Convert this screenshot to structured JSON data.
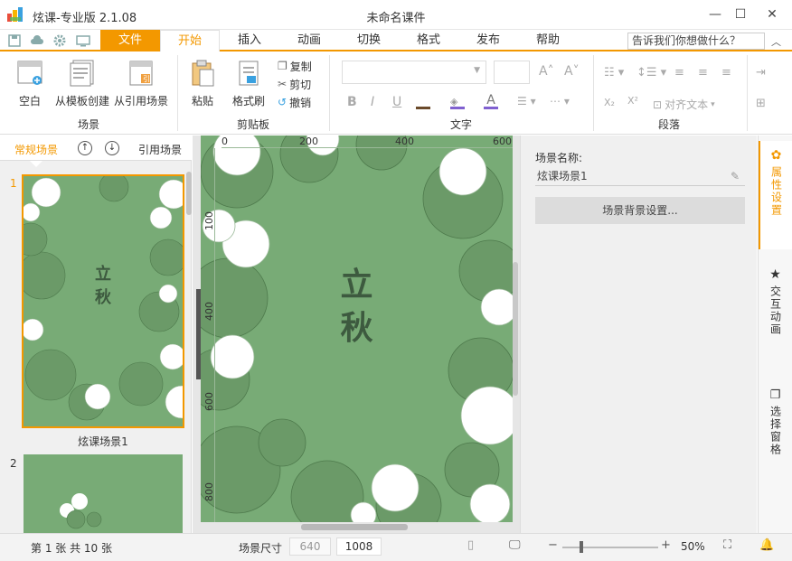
{
  "app": {
    "title": "炫课-专业版  2.1.08",
    "document_title": "未命名课件"
  },
  "window": {
    "minimize": "—",
    "maximize": "☐",
    "close": "✕"
  },
  "menu": {
    "file": "文件",
    "tabs": [
      "开始",
      "插入",
      "动画",
      "切换",
      "格式",
      "发布",
      "帮助"
    ],
    "active_tab": "开始",
    "help_search": "告诉我们你想做什么？"
  },
  "ribbon": {
    "scene_group": {
      "label": "场景",
      "blank": "空白",
      "from_template": "从模板创建",
      "from_reference": "从引用场景"
    },
    "clipboard_group": {
      "label": "剪贴板",
      "paste": "粘贴",
      "format_painter": "格式刷",
      "copy": "复制",
      "cut": "剪切",
      "undo": "撤销"
    },
    "text_group": {
      "label": "文字",
      "bold": "B",
      "italic": "I",
      "underline": "U"
    },
    "paragraph_group": {
      "label": "段落",
      "align_text": "对齐文本"
    }
  },
  "left_panel": {
    "tab_normal": "常规场景",
    "tab_reference": "引用场景",
    "slides": [
      {
        "number": "1",
        "name": "炫课场景1",
        "text": "立\n秋"
      },
      {
        "number": "2",
        "name": "",
        "text": ""
      }
    ]
  },
  "canvas": {
    "ruler_top": [
      "0",
      "200",
      "400",
      "600"
    ],
    "ruler_left": [
      "100",
      "400",
      "600",
      "800"
    ],
    "slide_text_line1": "立",
    "slide_text_line2": "秋",
    "thumb_text_line1": "立",
    "thumb_text_line2": "秋"
  },
  "properties": {
    "name_label": "场景名称:",
    "name_value": "炫课场景1",
    "bg_button": "场景背景设置..."
  },
  "side_tabs": [
    {
      "label": "属性设置",
      "icon": "gear-icon",
      "active": true
    },
    {
      "label": "交互动画",
      "icon": "star-icon",
      "active": false
    },
    {
      "label": "选择窗格",
      "icon": "layers-icon",
      "active": false
    }
  ],
  "status": {
    "page_info": "第 1 张  共 10 张",
    "size_label": "场景尺寸",
    "width": "640",
    "height": "1008",
    "zoom": "50%",
    "zoom_level": 0.5
  },
  "colors": {
    "accent": "#f39800",
    "slide_bg": "#78ab76",
    "slide_text": "#3d5a3f",
    "flower_white": "#ffffff",
    "flower_green": "#6b9a68"
  }
}
